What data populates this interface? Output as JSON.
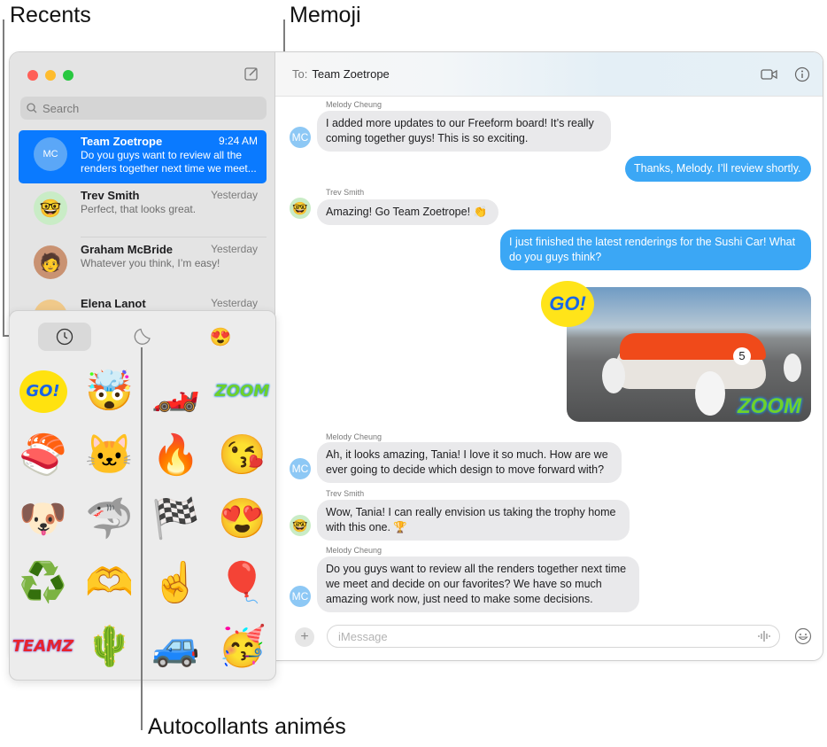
{
  "callouts": {
    "recents": "Recents",
    "memoji": "Memoji",
    "live_stickers": "Autocollants animés"
  },
  "window": {
    "traffic_lights": [
      "#ff5f57",
      "#febc2e",
      "#28c840"
    ],
    "compose_icon": "square-and-pencil-icon"
  },
  "sidebar": {
    "search_placeholder": "Search",
    "conversations": [
      {
        "name": "Team Zoetrope",
        "time": "9:24 AM",
        "preview": "Do you guys want to review all the renders together next time we meet...",
        "avatar": "group-avatar",
        "initials": "MC",
        "active": true
      },
      {
        "name": "Trev Smith",
        "time": "Yesterday",
        "preview": "Perfect, that looks great.",
        "avatar": "memoji-glasses",
        "active": false
      },
      {
        "name": "Graham McBride",
        "time": "Yesterday",
        "preview": "Whatever you think, I’m easy!",
        "avatar": "photo",
        "active": false
      },
      {
        "name": "Elena Lanot",
        "time": "Yesterday",
        "preview": "",
        "avatar": "memoji",
        "active": false
      }
    ]
  },
  "chat": {
    "to_label": "To:",
    "recipient": "Team Zoetrope",
    "header_icons": [
      "video-camera-icon",
      "info-icon"
    ],
    "messages": [
      {
        "sender": "Melody Cheung",
        "initials": "MC",
        "direction": "in",
        "text": "I added more updates to our Freeform board! It’s really coming together guys! This is so exciting."
      },
      {
        "direction": "out",
        "text": "Thanks, Melody. I’ll review shortly."
      },
      {
        "sender": "Trev Smith",
        "direction": "in",
        "text": "Amazing! Go Team Zoetrope! 👏"
      },
      {
        "direction": "out",
        "text": "I just finished the latest renderings for the Sushi Car! What do you guys think?"
      },
      {
        "direction": "out",
        "type": "image",
        "description": "Sushi car rendering",
        "car_number": "5",
        "stickers": [
          "GO!",
          "ZOOM"
        ]
      },
      {
        "sender": "Melody Cheung",
        "initials": "MC",
        "direction": "in",
        "text": "Ah, it looks amazing, Tania! I love it so much. How are we ever going to decide which design to move forward with?"
      },
      {
        "sender": "Trev Smith",
        "direction": "in",
        "text": "Wow, Tania! I can really envision us taking the trophy home with this one. 🏆"
      },
      {
        "sender": "Melody Cheung",
        "initials": "MC",
        "direction": "in",
        "text": "Do you guys want to review all the renders together next time we meet and decide on our favorites? We have so much amazing work now, just need to make some decisions."
      }
    ],
    "input_placeholder": "iMessage",
    "plus_label": "+",
    "input_icons": [
      "waveform-icon",
      "emoji-icon"
    ]
  },
  "sticker_popover": {
    "tabs": [
      {
        "name": "recents",
        "icon": "clock-icon",
        "active": true
      },
      {
        "name": "stickers",
        "icon": "peel-sticker-icon",
        "active": false
      },
      {
        "name": "memoji",
        "icon": "memoji-icon",
        "active": false
      }
    ],
    "stickers": [
      {
        "name": "go-sticker",
        "glyph": "GO!"
      },
      {
        "name": "mind-blown-memoji",
        "glyph": "🤯"
      },
      {
        "name": "race-car-sticker",
        "glyph": "🏎️"
      },
      {
        "name": "zoom-sticker",
        "glyph": "ZOOM"
      },
      {
        "name": "sushi-sticker",
        "glyph": "🍣"
      },
      {
        "name": "cat-sticker",
        "glyph": "🐱"
      },
      {
        "name": "flaming-car-sticker",
        "glyph": "🔥"
      },
      {
        "name": "blowing-kiss-memoji",
        "glyph": "😘"
      },
      {
        "name": "dog-in-coat-sticker",
        "glyph": "🐶"
      },
      {
        "name": "shark-mouth-sticker",
        "glyph": "🦈"
      },
      {
        "name": "checkered-flag-sticker",
        "glyph": "🏁"
      },
      {
        "name": "heart-eyes-memoji",
        "glyph": "😍"
      },
      {
        "name": "recycle-sticker",
        "glyph": "♻️"
      },
      {
        "name": "heart-hands-memoji",
        "glyph": "🫶"
      },
      {
        "name": "foam-finger-sticker",
        "glyph": "☝️"
      },
      {
        "name": "hot-air-balloon-sticker",
        "glyph": "🎈"
      },
      {
        "name": "team-z-sticker",
        "glyph": "TEAMZ"
      },
      {
        "name": "cactus-sticker",
        "glyph": "🌵"
      },
      {
        "name": "blue-car-sticker",
        "glyph": "🚙"
      },
      {
        "name": "party-memoji",
        "glyph": "🥳"
      }
    ]
  }
}
